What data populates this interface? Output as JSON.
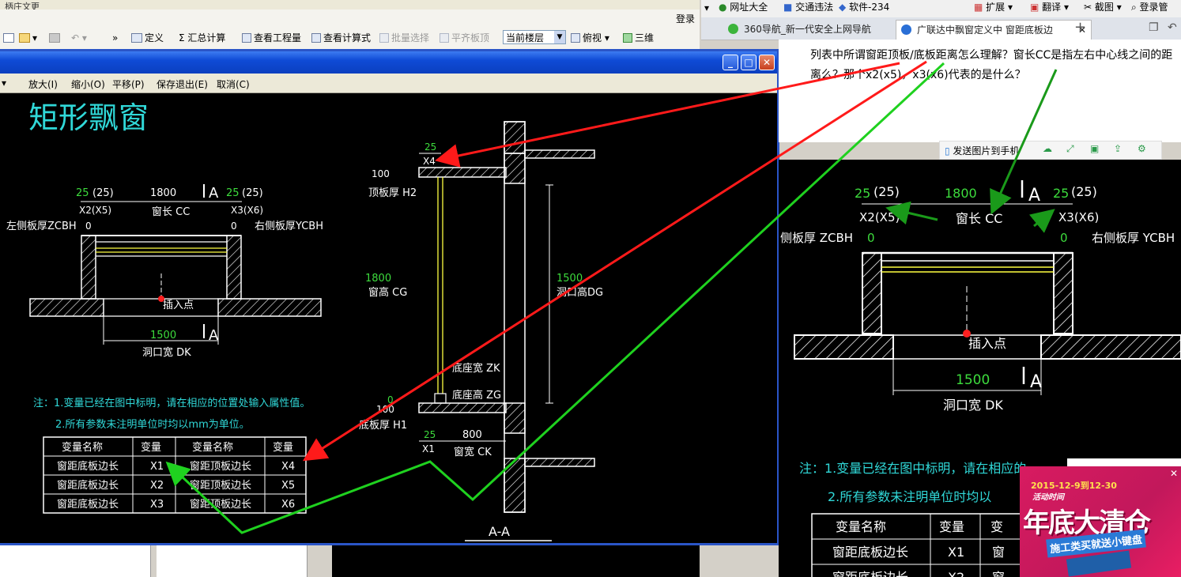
{
  "app": {
    "title": "柄庄文更",
    "login": "登录",
    "toolbar": [
      "定义",
      "汇总计算",
      "查看工程量",
      "查看计算式",
      "批量选择",
      "平齐板顶"
    ],
    "floor": "当前楼层",
    "view": "俯视",
    "three_d": "三维"
  },
  "dialog": {
    "tools": [
      "放大(I)",
      "缩小(O)",
      "平移(P)",
      "保存退出(E)",
      "取消(C)"
    ]
  },
  "drawing": {
    "title": "矩形飘窗",
    "plan": {
      "x2_dim": "25",
      "x2_paren": "(25)",
      "cc_dim": "1800",
      "x3_dim": "25",
      "x3_paren": "(25)",
      "section_mark": "A",
      "x2_label": "X2(X5)",
      "cc_label": "窗长 CC",
      "x3_label": "X3(X6)",
      "left_board": "左侧板厚ZCBH",
      "right_board": "右侧板厚YCBH",
      "zero_left": "0",
      "zero_right": "0",
      "insert_point": "插入点",
      "dk_dim": "1500",
      "dk_label": "洞口宽 DK"
    },
    "section": {
      "x4_dim": "25",
      "x4_label": "X4",
      "top_thick_dim": "100",
      "top_thick": "顶板厚 H2",
      "cg_dim": "1800",
      "cg_label": "窗高 CG",
      "dg_dim": "1500",
      "dg_label": "洞口高DG",
      "zk_label": "底座宽 ZK",
      "zg_label": "底座高 ZG",
      "zero": "0",
      "bottom_thick_dim": "100",
      "bottom_thick": "底板厚 H1",
      "x1_dim": "25",
      "ck_dim": "800",
      "x1_label": "X1",
      "ck_label": "窗宽 CK",
      "title": "A-A"
    },
    "notes": {
      "line1": "注：1.变量已经在图中标明，请在相应的位置处输入属性值。",
      "line2": "2.所有参数未注明单位时均以mm为单位。"
    },
    "table": {
      "headers": [
        "变量名称",
        "变量",
        "变量名称",
        "变量"
      ],
      "rows": [
        [
          "窗距底板边长",
          "X1",
          "窗距顶板边长",
          "X4"
        ],
        [
          "窗距底板边长",
          "X2",
          "窗距顶板边长",
          "X5"
        ],
        [
          "窗距底板边长",
          "X3",
          "窗距顶板边长",
          "X6"
        ]
      ]
    }
  },
  "browser": {
    "bookmarks": [
      "网址大全",
      "交通违法",
      "软件-234",
      "扩展",
      "翻译",
      "截图",
      "登录管"
    ],
    "tabs": [
      "360导航_新一代安全上网导航",
      "广联达中飘窗定义中 窗距底板边"
    ],
    "question": "列表中所谓窗距顶板/底板距离怎么理解？窗长CC是指左右中心线之间的距离么？那个x2(x5)，x3(x6)代表的是什么？",
    "send_to_phone": "发送图片到手机"
  },
  "right_image": {
    "x2_dim": "25",
    "x2_paren": "(25)",
    "cc_dim": "1800",
    "section_mark": "A",
    "x3_dim": "25",
    "x3_paren": "(25)",
    "x2_label": "X2(X5)",
    "cc_label": "窗长 CC",
    "x3_label": "X3(X6)",
    "left_board": "侧板厚 ZCBH",
    "right_board": "右侧板厚 YCBH",
    "zero_left": "0",
    "zero_right": "0",
    "insert_point": "插入点",
    "dk_dim": "1500",
    "dk_label": "洞口宽 DK",
    "note1": "注：1.变量已经在图中标明，请在相应的",
    "note2": "2.所有参数未注明单位时均以",
    "table_headers": [
      "变量名称",
      "变量",
      "变"
    ],
    "table_rows": [
      [
        "窗距底板边长",
        "X1",
        "窗"
      ],
      [
        "窗距底板边长",
        "X2",
        "窗"
      ]
    ]
  },
  "ad": {
    "date": "2015-12-9到12-30",
    "time": "活动时间",
    "headline": "年底大清仓",
    "sub": "施工类买就送小键盘"
  },
  "colors": {
    "cad_bg": "#000000",
    "cad_text": "#ffffff",
    "cad_green": "#3ddc3d",
    "cad_cyan": "#30d8d8",
    "cad_yellow": "#ffff40",
    "annot_red": "#ff1a1a",
    "annot_green": "#1fd11f",
    "title_blue": "#0f4bd6"
  }
}
